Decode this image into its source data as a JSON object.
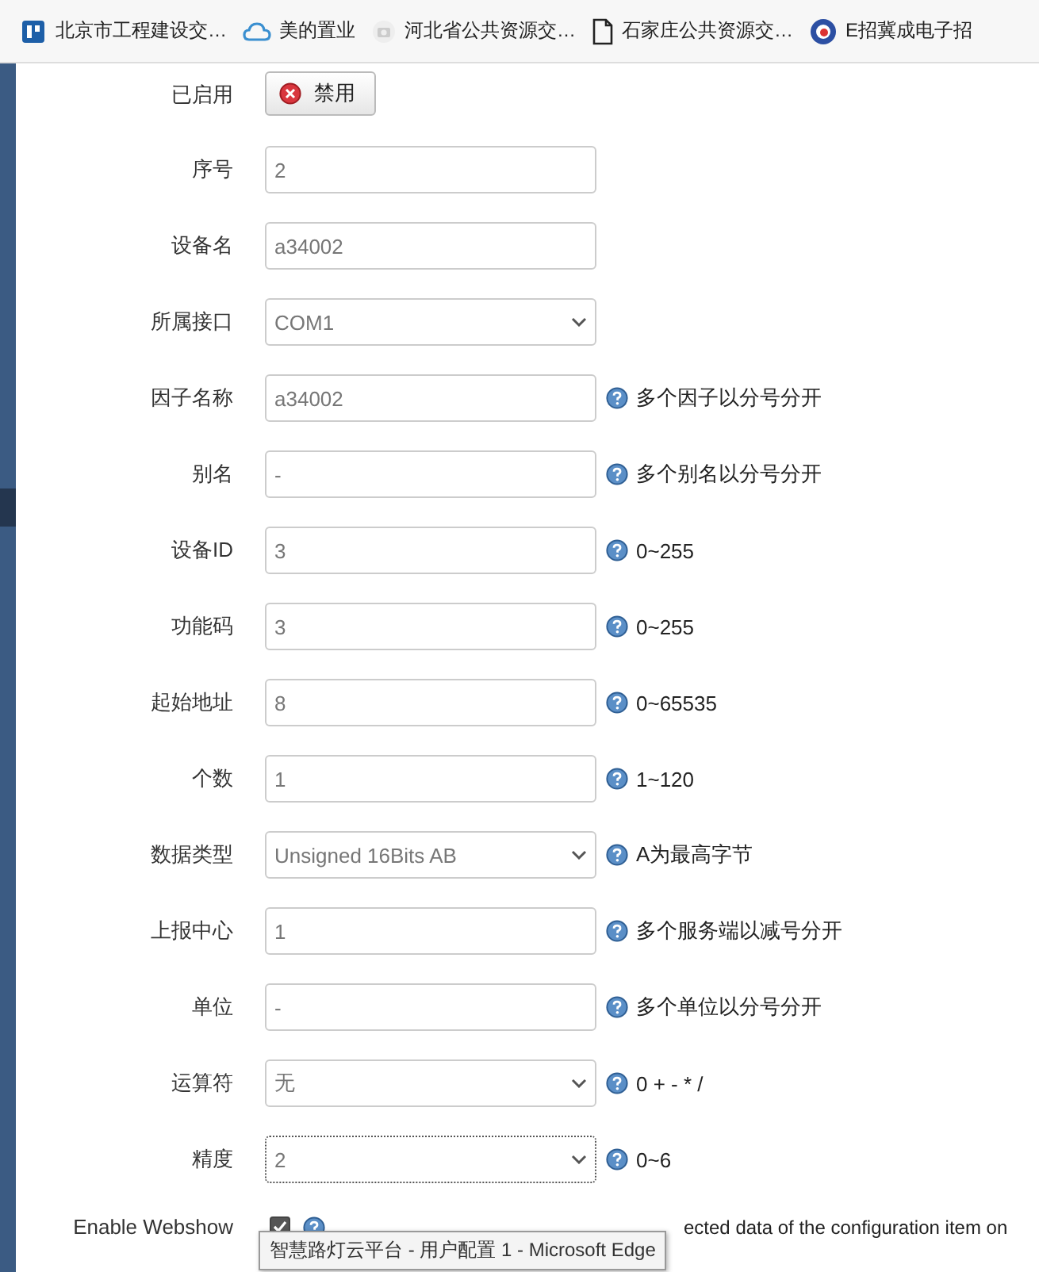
{
  "bookmarks": [
    {
      "label": "北京市工程建设交…"
    },
    {
      "label": "美的置业"
    },
    {
      "label": "河北省公共资源交…"
    },
    {
      "label": "石家庄公共资源交…"
    },
    {
      "label": "E招冀成电子招"
    }
  ],
  "form": {
    "rows": [
      {
        "label": "已启用",
        "kind": "button",
        "value": "禁用"
      },
      {
        "label": "序号",
        "kind": "input",
        "value": "2",
        "focused": false
      },
      {
        "label": "设备名",
        "kind": "input",
        "value": "a34002",
        "focused": false
      },
      {
        "label": "所属接口",
        "kind": "select",
        "value": "COM1",
        "focused": false
      },
      {
        "label": "因子名称",
        "kind": "input",
        "value": "a34002",
        "hint": "多个因子以分号分开",
        "focused": false
      },
      {
        "label": "别名",
        "kind": "input",
        "value": "-",
        "hint": "多个别名以分号分开",
        "focused": false
      },
      {
        "label": "设备ID",
        "kind": "input",
        "value": "3",
        "hint": "0~255",
        "focused": false
      },
      {
        "label": "功能码",
        "kind": "input",
        "value": "3",
        "hint": "0~255",
        "focused": false
      },
      {
        "label": "起始地址",
        "kind": "input",
        "value": "8",
        "hint": "0~65535",
        "focused": false
      },
      {
        "label": "个数",
        "kind": "input",
        "value": "1",
        "hint": "1~120",
        "focused": false
      },
      {
        "label": "数据类型",
        "kind": "select",
        "value": "Unsigned 16Bits AB",
        "hint": "A为最高字节",
        "focused": false
      },
      {
        "label": "上报中心",
        "kind": "input",
        "value": "1",
        "hint": "多个服务端以减号分开",
        "focused": false
      },
      {
        "label": "单位",
        "kind": "input",
        "value": "-",
        "hint": "多个单位以分号分开",
        "focused": false
      },
      {
        "label": "运算符",
        "kind": "select",
        "value": "无",
        "hint": "0 + - * /",
        "focused": false
      },
      {
        "label": "精度",
        "kind": "select",
        "value": "2",
        "hint": "0~6",
        "focused": true
      }
    ]
  },
  "webshow": {
    "label": "Enable Webshow",
    "checked": true,
    "hint": "ected data of the configuration item on"
  },
  "tooltip": {
    "text": "智慧路灯云平台 - 用户配置 1 - Microsoft Edge"
  }
}
